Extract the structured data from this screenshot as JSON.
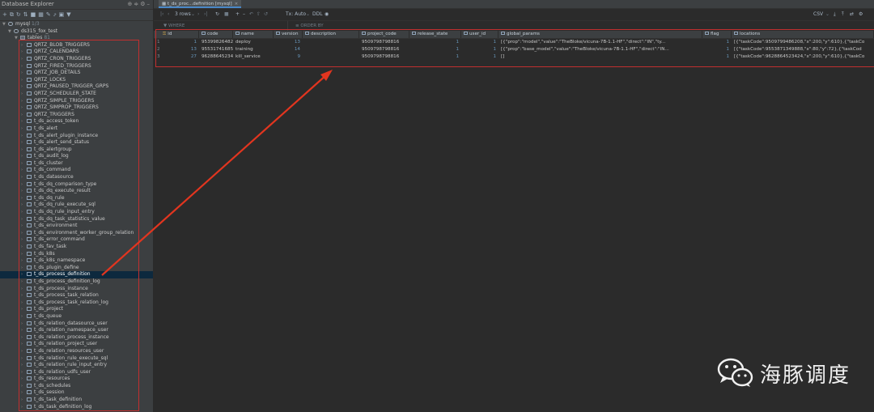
{
  "explorer": {
    "title": "Database Explorer",
    "toolbar_icons": [
      "add-icon",
      "duplicate-icon",
      "refresh-icon",
      "sync-icon",
      "stop-icon",
      "table-icon",
      "edit-icon",
      "jump-icon",
      "console-icon",
      "filter-icon"
    ],
    "title_tools": [
      "globe-icon",
      "collapse-icon",
      "settings-icon",
      "minimize-icon"
    ],
    "root": {
      "label": "mysql",
      "count": "1/3"
    },
    "schema": {
      "label": "ds315_fox_test"
    },
    "tables_folder": {
      "label": "tables",
      "count": "81"
    },
    "tables": [
      "QRTZ_BLOB_TRIGGERS",
      "QRTZ_CALENDARS",
      "QRTZ_CRON_TRIGGERS",
      "QRTZ_FIRED_TRIGGERS",
      "QRTZ_JOB_DETAILS",
      "QRTZ_LOCKS",
      "QRTZ_PAUSED_TRIGGER_GRPS",
      "QRTZ_SCHEDULER_STATE",
      "QRTZ_SIMPLE_TRIGGERS",
      "QRTZ_SIMPROP_TRIGGERS",
      "QRTZ_TRIGGERS",
      "t_ds_access_token",
      "t_ds_alert",
      "t_ds_alert_plugin_instance",
      "t_ds_alert_send_status",
      "t_ds_alertgroup",
      "t_ds_audit_log",
      "t_ds_cluster",
      "t_ds_command",
      "t_ds_datasource",
      "t_ds_dq_comparison_type",
      "t_ds_dq_execute_result",
      "t_ds_dq_rule",
      "t_ds_dq_rule_execute_sql",
      "t_ds_dq_rule_input_entry",
      "t_ds_dq_task_statistics_value",
      "t_ds_environment",
      "t_ds_environment_worker_group_relation",
      "t_ds_error_command",
      "t_ds_fav_task",
      "t_ds_k8s",
      "t_ds_k8s_namespace",
      "t_ds_plugin_define",
      "t_ds_process_definition",
      "t_ds_process_definition_log",
      "t_ds_process_instance",
      "t_ds_process_task_relation",
      "t_ds_process_task_relation_log",
      "t_ds_project",
      "t_ds_queue",
      "t_ds_relation_datasource_user",
      "t_ds_relation_namespace_user",
      "t_ds_relation_process_instance",
      "t_ds_relation_project_user",
      "t_ds_relation_resources_user",
      "t_ds_relation_rule_execute_sql",
      "t_ds_relation_rule_input_entry",
      "t_ds_relation_udfs_user",
      "t_ds_resources",
      "t_ds_schedules",
      "t_ds_session",
      "t_ds_task_definition",
      "t_ds_task_definition_log"
    ],
    "selected_table": "t_ds_process_definition"
  },
  "editor": {
    "tab_label": "t_ds_proc...definition [mysql]",
    "toolbar": {
      "rows_label": "3 rows",
      "tx_label": "Tx: Auto",
      "ddl_label": "DDL",
      "format_label": "CSV"
    },
    "filters": {
      "where": "WHERE",
      "order_by": "ORDER BY"
    },
    "columns": [
      "id",
      "code",
      "name",
      "version",
      "description",
      "project_code",
      "release_state",
      "user_id",
      "global_params",
      "flag",
      "locations"
    ],
    "rows": [
      {
        "num": "1",
        "id": "1",
        "code": "9539982648256",
        "name": "deploy",
        "version": "13",
        "description": "",
        "project_code": "9509798798816",
        "release_state": "1",
        "user_id": "1",
        "global_params": "[{\"prop\":\"model\",\"value\":\"TheBloke/vicuna-7B-1.1-HF\",\"direct\":\"IN\",\"ty...",
        "flag": "1",
        "locations": "[{\"taskCode\":9509799486208,\"x\":200,\"y\":610},{\"taskCo"
      },
      {
        "num": "2",
        "id": "13",
        "code": "9553174168576",
        "name": "training",
        "version": "14",
        "description": "",
        "project_code": "9509798798816",
        "release_state": "1",
        "user_id": "1",
        "global_params": "[{\"prop\":\"base_model\",\"value\":\"TheBloke/vicuna-7B-1.1-HF\",\"direct\":\"IN...",
        "flag": "1",
        "locations": "[{\"taskCode\":9553871349888,\"x\":80,\"y\":72},{\"taskCod"
      },
      {
        "num": "3",
        "id": "27",
        "code": "9628864523427",
        "name": "kill_service",
        "version": "9",
        "description": "",
        "project_code": "9509798798816",
        "release_state": "1",
        "user_id": "1",
        "global_params": "[]",
        "flag": "1",
        "locations": "[{\"taskCode\":9628864523424,\"x\":200,\"y\":610},{\"taskCo"
      }
    ]
  },
  "watermark": {
    "text": "海豚调度",
    "icon": "wechat-icon"
  },
  "colors": {
    "highlight_box": "#c12f2f",
    "arrow": "#e2351f",
    "selection": "#0d293e"
  }
}
